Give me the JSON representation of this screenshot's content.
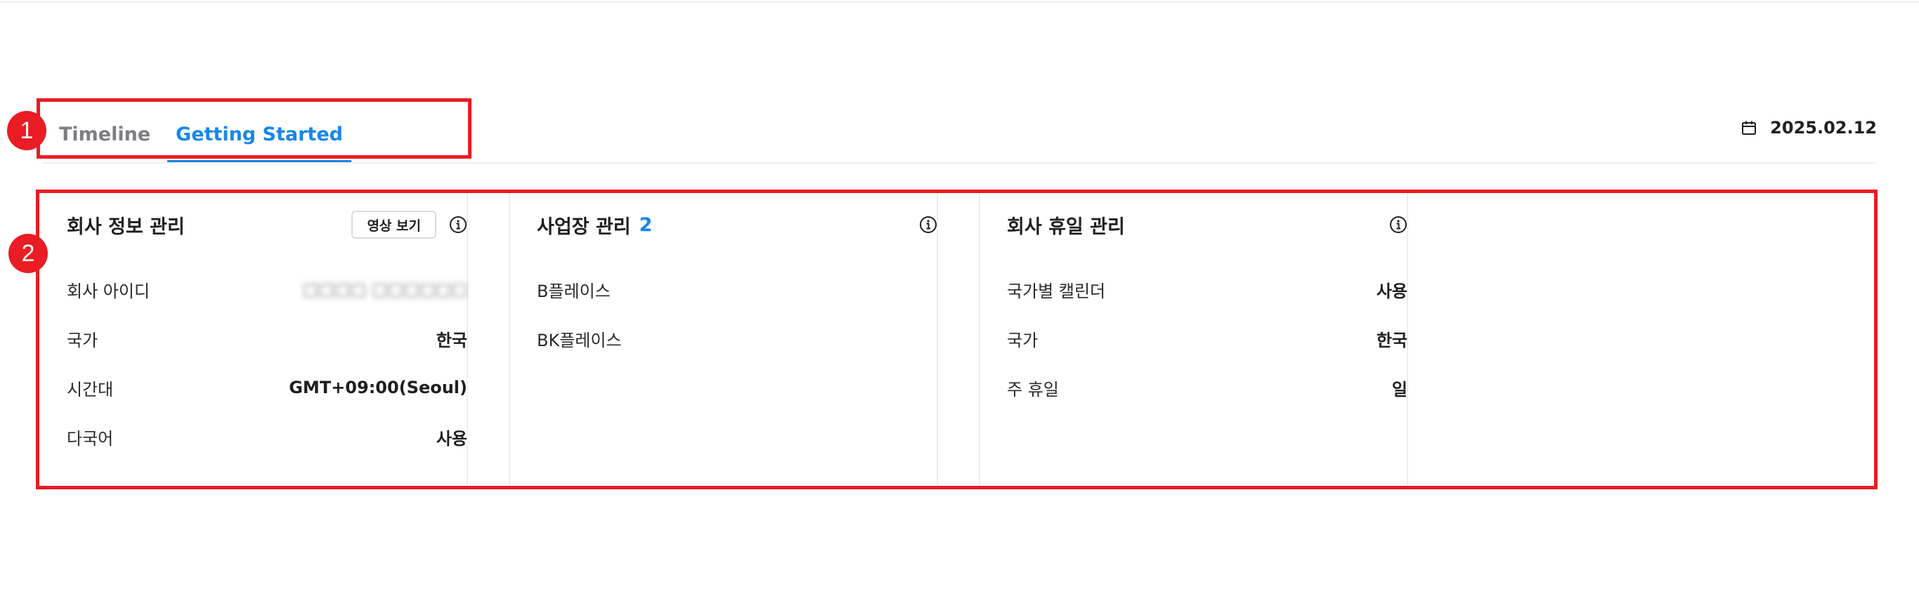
{
  "tabs": {
    "items": [
      {
        "label": "Timeline",
        "active": false
      },
      {
        "label": "Getting Started",
        "active": true
      }
    ],
    "accent_color": "#1887e8",
    "inactive_color": "#7b7e84"
  },
  "date": {
    "icon": "calendar-icon",
    "value": "2025.02.12"
  },
  "annotations": {
    "badge_1": "1",
    "badge_2": "2",
    "color": "#ea1c24"
  },
  "cards": {
    "company_info": {
      "title": "회사 정보 관리",
      "video_button": "영상 보기",
      "info_icon": "info-icon",
      "rows": [
        {
          "label": "회사 아이디",
          "value": "□□□□ □□□□□□",
          "blurred": true
        },
        {
          "label": "국가",
          "value": "한국"
        },
        {
          "label": "시간대",
          "value": "GMT+09:00(Seoul)"
        },
        {
          "label": "다국어",
          "value": "사용"
        }
      ]
    },
    "workplace": {
      "title": "사업장 관리",
      "count": "2",
      "info_icon": "info-icon",
      "rows": [
        {
          "label": "B플레이스"
        },
        {
          "label": "BK플레이스"
        }
      ]
    },
    "holidays": {
      "title": "회사 휴일 관리",
      "info_icon": "info-icon",
      "rows": [
        {
          "label": "국가별 캘린더",
          "value": "사용"
        },
        {
          "label": "국가",
          "value": "한국"
        },
        {
          "label": "주 휴일",
          "value": "일"
        }
      ]
    }
  }
}
